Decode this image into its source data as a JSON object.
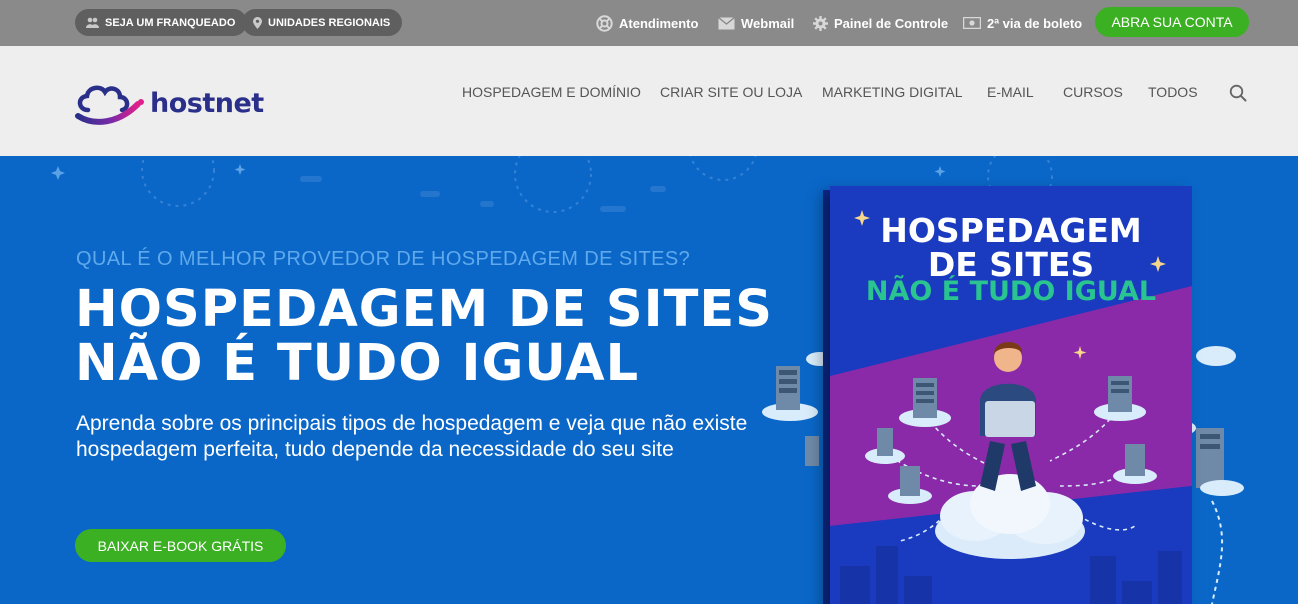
{
  "topbar": {
    "franchise_label": "SEJA UM FRANQUEADO",
    "regional_label": "UNIDADES REGIONAIS",
    "support_label": "Atendimento",
    "webmail_label": "Webmail",
    "control_panel_label": "Painel de Controle",
    "boleto_label": "2ª via de boleto",
    "open_account_label": "ABRA SUA CONTA",
    "icons": [
      "users-icon",
      "map-pin-icon",
      "lifebuoy-icon",
      "envelope-icon",
      "gear-icon",
      "money-icon"
    ]
  },
  "header": {
    "logo_text": "hostnet",
    "nav": [
      {
        "label": "HOSPEDAGEM E DOMÍNIO"
      },
      {
        "label": "CRIAR SITE OU LOJA"
      },
      {
        "label": "MARKETING DIGITAL"
      },
      {
        "label": "E-MAIL"
      },
      {
        "label": "CURSOS"
      },
      {
        "label": "TODOS"
      }
    ],
    "search_icon": "search-icon"
  },
  "hero": {
    "kicker": "QUAL É O MELHOR PROVEDOR DE HOSPEDAGEM DE SITES?",
    "headline_line1": "HOSPEDAGEM DE SITES",
    "headline_line2": "NÃO É TUDO IGUAL",
    "subtitle": "Aprenda sobre os principais tipos de hospedagem e veja que não existe hospedagem perfeita, tudo depende da necessidade do seu site",
    "cta_label": "BAIXAR E-BOOK GRÁTIS"
  },
  "ebook": {
    "title_line1": "HOSPEDAGEM",
    "title_line2": "DE SITES",
    "title_line3": "NÃO É TUDO IGUAL"
  },
  "colors": {
    "topbar_bg": "#8a8a8a",
    "header_bg": "#eeeeee",
    "hero_bg": "#0a67c8",
    "cta_green": "#3cb023",
    "logo_blue": "#2a2f8a",
    "book_green": "#29c48f"
  }
}
